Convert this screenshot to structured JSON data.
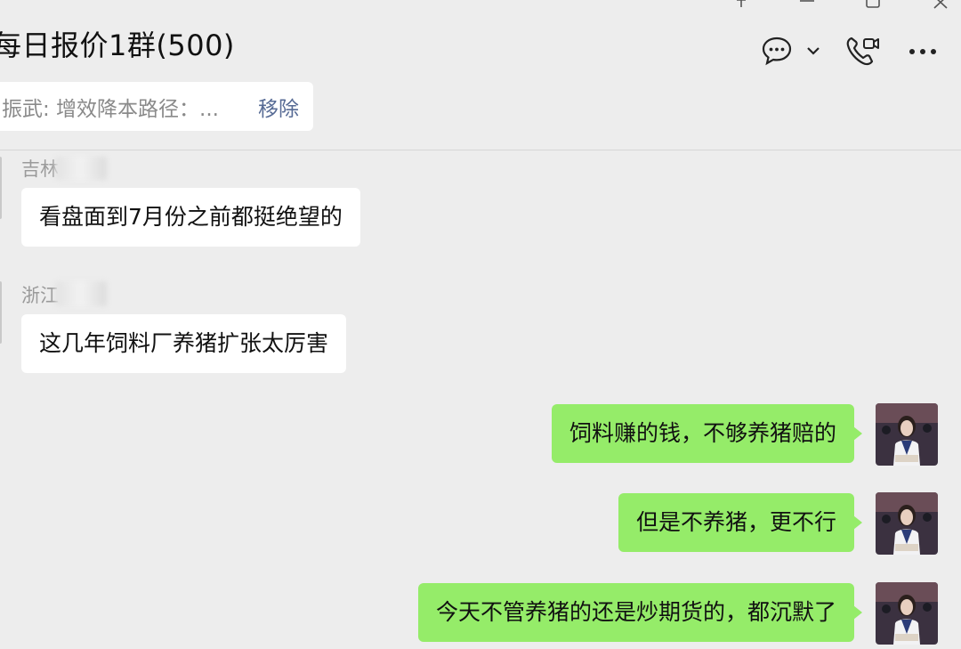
{
  "window": {
    "pin_icon": "pin-icon",
    "minimize_icon": "minimize-icon",
    "maximize_icon": "maximize-icon",
    "close_icon": "close-icon"
  },
  "header": {
    "title": "每日报价1群(500)",
    "chat_icon": "chat-bubble-icon",
    "dropdown_icon": "chevron-down-icon",
    "call_icon": "video-call-icon",
    "more_icon": "more-icon"
  },
  "pinned": {
    "text": "振武: 增效降本路径：...",
    "remove_label": "移除"
  },
  "messages": [
    {
      "sender": "吉林",
      "text": "看盘面到7月份之前都挺绝望的",
      "direction": "in"
    },
    {
      "sender": "浙江",
      "text": "这几年饲料厂养猪扩张太厉害",
      "direction": "in"
    },
    {
      "text": "饲料赚的钱，不够养猪赔的",
      "direction": "out"
    },
    {
      "text": "但是不养猪，更不行",
      "direction": "out"
    },
    {
      "text": "今天不管养猪的还是炒期货的，都沉默了",
      "direction": "out"
    }
  ],
  "colors": {
    "background": "#ededed",
    "incoming_bubble": "#ffffff",
    "outgoing_bubble": "#95ec69",
    "link": "#576b95"
  }
}
